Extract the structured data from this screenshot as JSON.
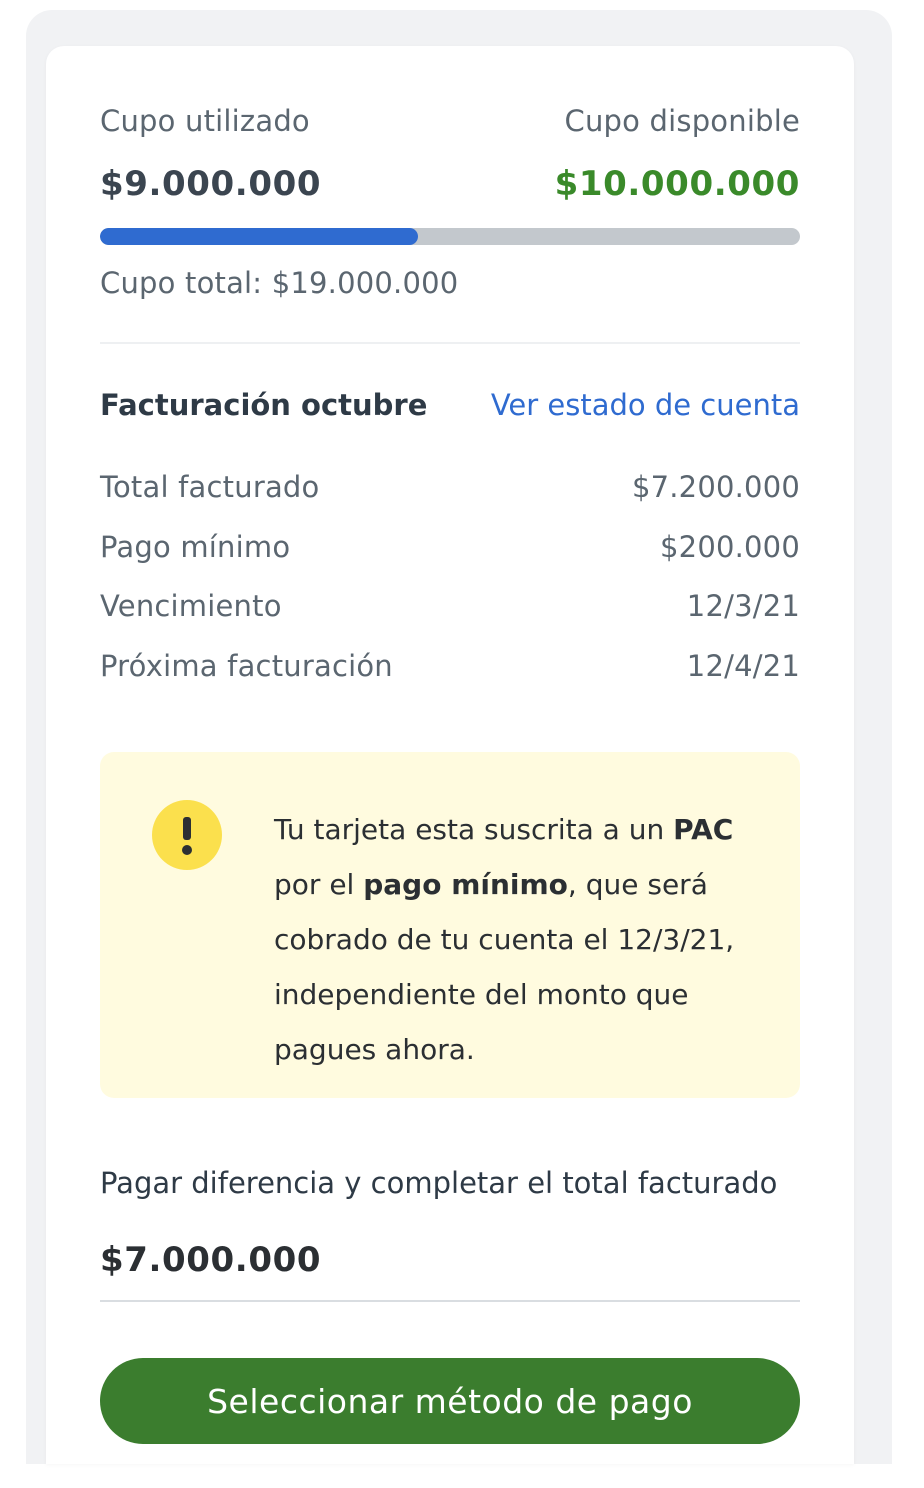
{
  "credit": {
    "used_label": "Cupo utilizado",
    "used_amount": "$9.000.000",
    "available_label": "Cupo disponible",
    "available_amount": "$10.000.000",
    "total_label": "Cupo total: $19.000.000",
    "used_fraction": 0.4545,
    "used_color": "#2f6bd0",
    "available_color": "#3a8a2a"
  },
  "billing": {
    "title": "Facturación octubre",
    "statement_link": "Ver estado de cuenta",
    "rows": [
      {
        "label": "Total facturado",
        "value": "$7.200.000"
      },
      {
        "label": "Pago mínimo",
        "value": "$200.000"
      },
      {
        "label": "Vencimiento",
        "value": "12/3/21"
      },
      {
        "label": "Próxima facturación",
        "value": "12/4/21"
      }
    ]
  },
  "alert": {
    "icon": "exclamation-icon",
    "text_1": "Tu tarjeta esta suscrita a un ",
    "bold_1": "PAC",
    "text_2": " por el ",
    "bold_2": "pago mínimo",
    "text_3": ", que será cobrado de tu cuenta el 12/3/21, independiente del monto que pagues ahora.",
    "background": "#fffbdf",
    "icon_color": "#fbe04d"
  },
  "payment": {
    "label": "Pagar diferencia y completar el total facturado",
    "amount": "$7.000.000",
    "button_label": "Seleccionar método de pago",
    "button_color": "#3b7d2e"
  }
}
